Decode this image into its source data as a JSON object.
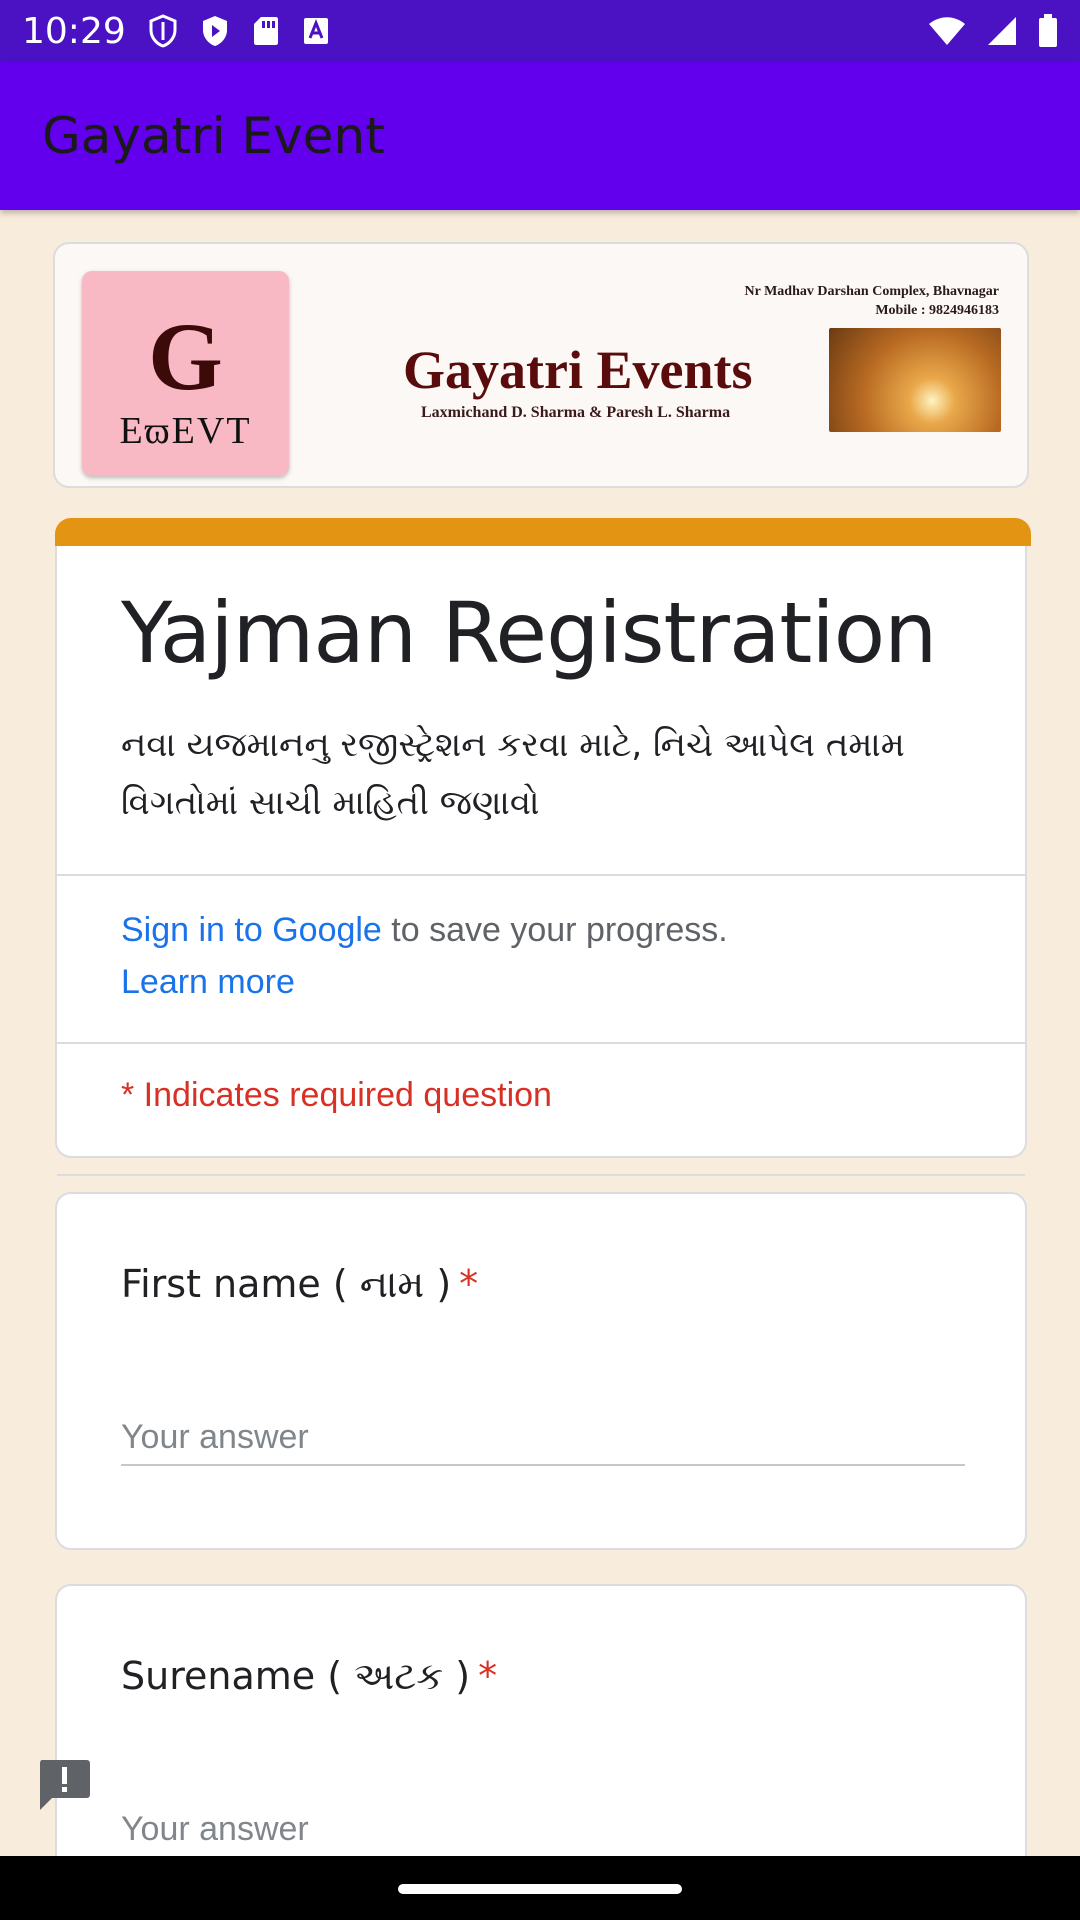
{
  "status_bar": {
    "time": "10:29",
    "left_icons": [
      "shield-icon",
      "play-protect-icon",
      "sd-card-icon",
      "text-icon"
    ],
    "right_icons": [
      "wifi-icon",
      "signal-icon",
      "battery-icon"
    ]
  },
  "app_bar": {
    "title": "Gayatri Event"
  },
  "banner": {
    "logo_letter": "G",
    "logo_subtext": "EϖEVT",
    "address": "Nr Madhav Darshan Complex, Bhavnagar",
    "mobile": "Mobile : 9824946183",
    "name": "Gayatri Events",
    "owners": "Laxmichand D. Sharma & Paresh L. Sharma"
  },
  "form": {
    "title": "Yajman Registration",
    "description": "નવા યજમાનનુ રજીસ્ટ્રેશન કરવા માટે, નિચે આપેલ તમામ વિગતોમાં સાચી માહિતી જણાવો",
    "sign_in_link": "Sign in to Google",
    "sign_in_rest": " to save your progress.",
    "learn_more": "Learn more",
    "required_note": "* Indicates required question"
  },
  "questions": [
    {
      "label": "First name ( નામ )",
      "required_mark": "*",
      "placeholder": "Your answer"
    },
    {
      "label": "Surename ( અટક )",
      "required_mark": "*",
      "placeholder": "Your answer"
    }
  ],
  "colors": {
    "status_bar": "#4a12c2",
    "app_bar": "#6200ee",
    "background": "#f8ecdc",
    "accent_strip": "#e39412",
    "link": "#1a73e8",
    "required": "#d93025"
  }
}
